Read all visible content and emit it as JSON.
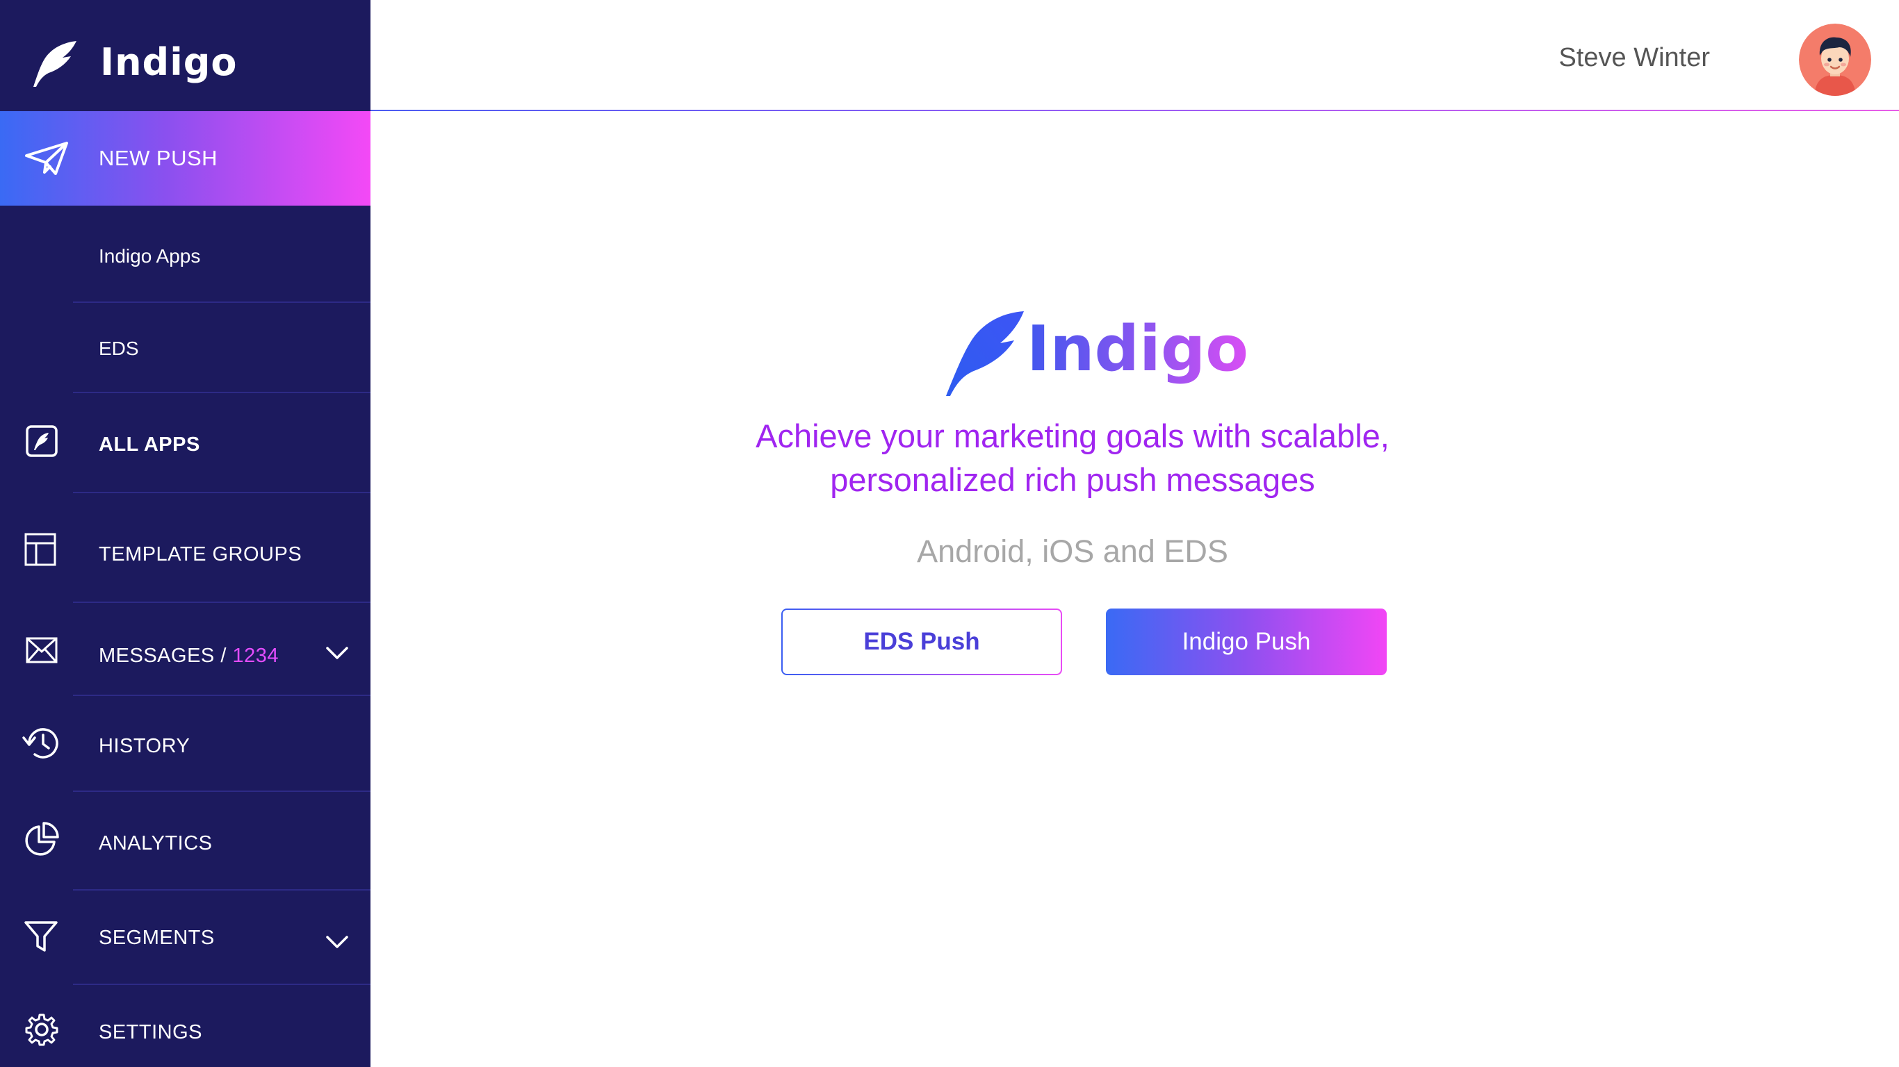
{
  "app": {
    "name": "Indigo"
  },
  "user": {
    "name": "Steve Winter"
  },
  "sidebar": {
    "items": [
      {
        "label": "NEW PUSH",
        "icon": "paper-plane-icon",
        "active": true
      },
      {
        "label": "Indigo Apps",
        "sub": true
      },
      {
        "label": "EDS",
        "sub": true
      },
      {
        "label": "ALL APPS",
        "icon": "feather-box-icon",
        "bold": true
      },
      {
        "label": "TEMPLATE GROUPS",
        "icon": "layout-icon"
      },
      {
        "label": "MESSAGES /",
        "count": "1234",
        "icon": "envelope-icon",
        "expandable": true
      },
      {
        "label": "HISTORY",
        "icon": "history-icon"
      },
      {
        "label": "ANALYTICS",
        "icon": "pie-chart-icon"
      },
      {
        "label": "SEGMENTS",
        "icon": "filter-icon",
        "expandable": true
      },
      {
        "label": "SETTINGS",
        "icon": "gear-icon"
      }
    ]
  },
  "hero": {
    "title": "Indigo",
    "tagline_line1": "Achieve your marketing goals with scalable,",
    "tagline_line2": "personalized rich push messages",
    "platforms": "Android, iOS and EDS",
    "buttons": {
      "eds_push": "EDS Push",
      "indigo_push": "Indigo Push"
    }
  },
  "colors": {
    "sidebar_bg": "#1c1a5e",
    "accent_start": "#3a6af4",
    "accent_end": "#f449f6",
    "tagline": "#a025f0",
    "count": "#e44dff"
  }
}
